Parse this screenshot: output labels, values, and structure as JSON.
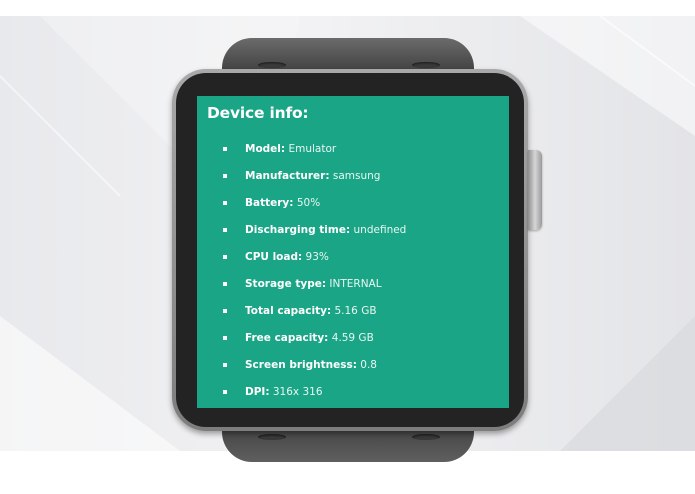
{
  "screen": {
    "title": "Device info:",
    "background": "#1aa586",
    "items": [
      {
        "label": "Model:",
        "value": "Emulator"
      },
      {
        "label": "Manufacturer:",
        "value": "samsung"
      },
      {
        "label": "Battery:",
        "value": "50%"
      },
      {
        "label": "Discharging time:",
        "value": "undefined"
      },
      {
        "label": "CPU load:",
        "value": "93%"
      },
      {
        "label": "Storage type:",
        "value": "INTERNAL"
      },
      {
        "label": "Total capacity:",
        "value": "5.16 GB"
      },
      {
        "label": "Free capacity:",
        "value": "4.59 GB"
      },
      {
        "label": "Screen brightness:",
        "value": "0.8"
      },
      {
        "label": "DPI:",
        "value": "316x 316"
      }
    ]
  }
}
